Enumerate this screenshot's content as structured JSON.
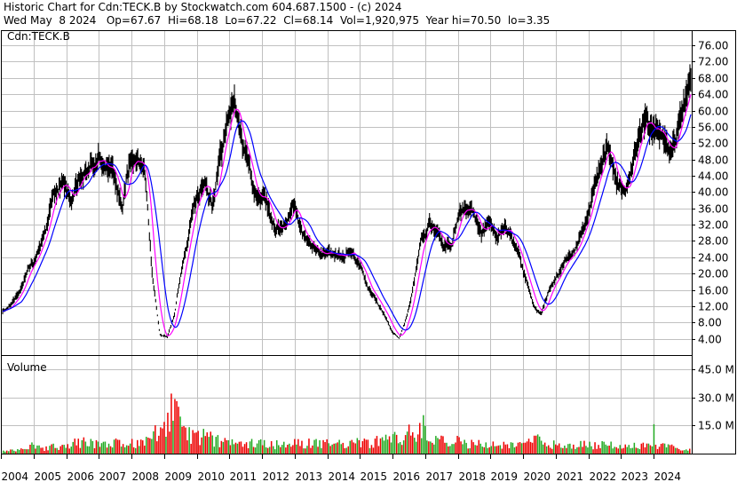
{
  "header": {
    "line1": "Historic Chart for Cdn:TECK.B by Stockwatch.com 604.687.1500 - (c) 2024",
    "line2": "Wed May  8 2024   Op=67.67  Hi=68.18  Lo=67.22  Cl=68.14  Vol=1,920,975  Year hi=70.50  lo=3.35"
  },
  "colors": {
    "price": "#000000",
    "ma_short": "#ff00ff",
    "ma_long": "#0000ff",
    "volume_up": "#22aa22",
    "volume_down": "#ee0000",
    "grid": "#c0c0c0"
  },
  "chart_data": [
    {
      "type": "line",
      "title": "Cdn:TECK.B",
      "series": [
        {
          "values": [
            10.5,
            12,
            15,
            19,
            22,
            27,
            33,
            40,
            42,
            38,
            41,
            44,
            46,
            48,
            47,
            43,
            36,
            47,
            48,
            44,
            20,
            5,
            4.5,
            10,
            22,
            32,
            40,
            44,
            38,
            48,
            57,
            63,
            52,
            46,
            38,
            40,
            33,
            30,
            33,
            37,
            30,
            27,
            26,
            26,
            25,
            25,
            26,
            24,
            21,
            17,
            14,
            10,
            6,
            4,
            9,
            18,
            29,
            32,
            30,
            26,
            27,
            34,
            36,
            35,
            30,
            32,
            30,
            31,
            28,
            24,
            19,
            12,
            10,
            15,
            18,
            22,
            24,
            27,
            33,
            40,
            46,
            52,
            42,
            40,
            45,
            52,
            58,
            54,
            53,
            51,
            54,
            60,
            68.14
          ]
        }
      ],
      "x_tick_labels": [
        "2004",
        "2005",
        "2006",
        "2007",
        "2008",
        "2009",
        "2010",
        "2011",
        "2012",
        "2013",
        "2014",
        "2015",
        "2016",
        "2017",
        "2018",
        "2019",
        "2020",
        "2021",
        "2022",
        "2023",
        "2024"
      ],
      "y_tick_labels": [
        "4.00",
        "8.00",
        "12.00",
        "16.00",
        "20.00",
        "24.00",
        "28.00",
        "32.00",
        "36.00",
        "40.00",
        "44.00",
        "48.00",
        "52.00",
        "56.00",
        "60.00",
        "64.00",
        "68.00",
        "72.00",
        "76.00"
      ],
      "ylim": [
        0,
        79.5
      ],
      "grid": true
    },
    {
      "type": "bar",
      "title": "Volume",
      "series": [
        {
          "values": [
            1.2,
            1.5,
            2.3,
            4.2,
            2.6,
            3.5,
            4.3,
            4.6,
            6.6,
            5.6,
            4.7,
            4.8,
            5.2,
            5.5,
            6.5,
            7.6,
            13.5,
            19,
            23.5,
            10.8,
            9.8,
            9.2,
            7.6,
            5.8,
            5.4,
            5.2,
            5.6,
            5.3,
            5.1,
            4.8,
            5.1,
            5.4,
            5.8,
            5.4,
            5.2,
            5.3,
            5.5,
            5.7,
            5.9,
            6.6,
            7.1,
            7.8,
            8.9,
            12.5,
            14.5,
            10.4,
            8.6,
            7.5,
            6.9,
            5.5,
            5.1,
            4.8,
            4.5,
            4.4,
            4.3,
            5.3,
            8.5,
            5.3,
            4.8,
            4.5,
            4.3,
            5.2,
            4.7,
            4.9,
            4.6,
            4.3,
            4.1,
            4.2,
            4.4,
            3.9,
            3.6,
            3.2,
            3.4
          ],
          "max": [
            1.6,
            2.4,
            3.6,
            6.6,
            4.2,
            5.6,
            8.2,
            7.2,
            9.6,
            8.6,
            7.6,
            7.8,
            8.2,
            8.5,
            10.4,
            11,
            28.4,
            31,
            33.5,
            18.5,
            14.2,
            13.2,
            11.2,
            8.6,
            7.6,
            7.2,
            7.8,
            7.6,
            8.2,
            7.4,
            7.7,
            7.8,
            8.5,
            7.9,
            7.6,
            7.5,
            8,
            8.2,
            8.6,
            10.3,
            11,
            11.8,
            14.5,
            20,
            26,
            16.4,
            11.5,
            10.2,
            9,
            7.6,
            7.2,
            6.6,
            6.2,
            6.4,
            6,
            8,
            19.7,
            8.1,
            7.2,
            6.6,
            6.2,
            7.6,
            6.8,
            7.4,
            6.8,
            6.4,
            6,
            6.2,
            18.9,
            6.1,
            5.6,
            4.8,
            5.6
          ]
        }
      ],
      "x_tick_labels": [
        "2004",
        "2005",
        "2006",
        "2007",
        "2008",
        "2009",
        "2010",
        "2011",
        "2012",
        "2013",
        "2014",
        "2015",
        "2016",
        "2017",
        "2018",
        "2019",
        "2020",
        "2021",
        "2022",
        "2023",
        "2024"
      ],
      "y_tick_labels": [
        "15.0 M",
        "30.0 M",
        "45.0 M"
      ],
      "ylim": [
        0,
        52
      ],
      "grid": true
    }
  ]
}
